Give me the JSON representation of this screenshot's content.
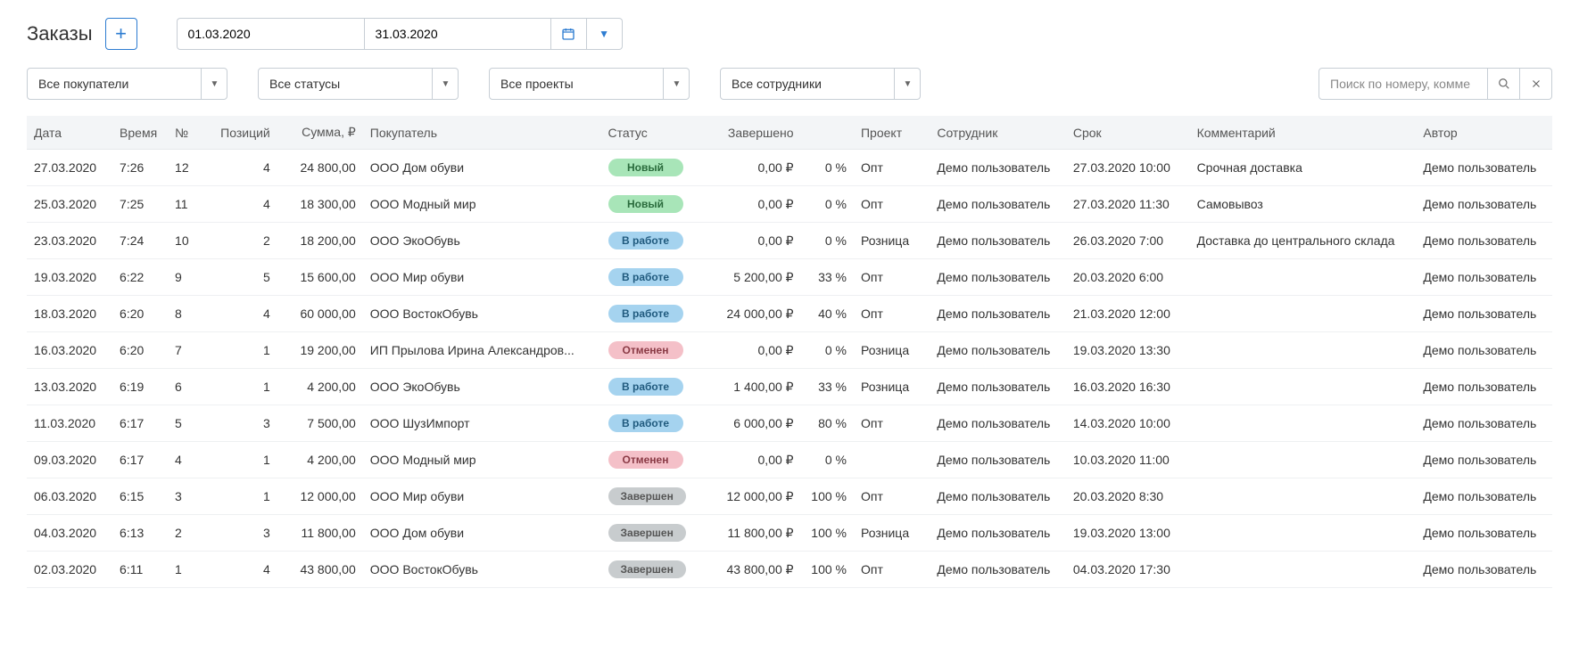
{
  "page_title": "Заказы",
  "date_from": "01.03.2020",
  "date_to": "31.03.2020",
  "filters": {
    "buyers": "Все покупатели",
    "statuses": "Все статусы",
    "projects": "Все проекты",
    "employees": "Все сотрудники"
  },
  "search_placeholder": "Поиск по номеру, комме",
  "columns": {
    "date": "Дата",
    "time": "Время",
    "num": "№",
    "positions": "Позиций",
    "sum": "Сумма, ₽",
    "buyer": "Покупатель",
    "status": "Статус",
    "completed": "Завершено",
    "percent": "",
    "project": "Проект",
    "employee": "Сотрудник",
    "due": "Срок",
    "comment": "Комментарий",
    "author": "Автор"
  },
  "status_labels": {
    "new": "Новый",
    "work": "В работе",
    "cancel": "Отменен",
    "done": "Завершен"
  },
  "rows": [
    {
      "date": "27.03.2020",
      "time": "7:26",
      "num": "12",
      "positions": "4",
      "sum": "24 800,00",
      "buyer": "ООО Дом обуви",
      "status": "new",
      "done": "0,00 ₽",
      "pct": "0 %",
      "project": "Опт",
      "employee": "Демо пользователь",
      "due": "27.03.2020 10:00",
      "due_overdue": false,
      "comment": "Срочная доставка",
      "author": "Демо пользователь"
    },
    {
      "date": "25.03.2020",
      "time": "7:25",
      "num": "11",
      "positions": "4",
      "sum": "18 300,00",
      "buyer": "ООО Модный мир",
      "status": "new",
      "done": "0,00 ₽",
      "pct": "0 %",
      "project": "Опт",
      "employee": "Демо пользователь",
      "due": "27.03.2020 11:30",
      "due_overdue": false,
      "comment": "Самовывоз",
      "author": "Демо пользователь"
    },
    {
      "date": "23.03.2020",
      "time": "7:24",
      "num": "10",
      "positions": "2",
      "sum": "18 200,00",
      "buyer": "ООО ЭкоОбувь",
      "status": "work",
      "done": "0,00 ₽",
      "pct": "0 %",
      "project": "Розница",
      "employee": "Демо пользователь",
      "due": "26.03.2020 7:00",
      "due_overdue": false,
      "comment": "Доставка до центрального склада",
      "author": "Демо пользователь"
    },
    {
      "date": "19.03.2020",
      "time": "6:22",
      "num": "9",
      "positions": "5",
      "sum": "15 600,00",
      "buyer": "ООО Мир обуви",
      "status": "work",
      "done": "5 200,00 ₽",
      "pct": "33 %",
      "project": "Опт",
      "employee": "Демо пользователь",
      "due": "20.03.2020 6:00",
      "due_overdue": false,
      "comment": "",
      "author": "Демо пользователь"
    },
    {
      "date": "18.03.2020",
      "time": "6:20",
      "num": "8",
      "positions": "4",
      "sum": "60 000,00",
      "buyer": "ООО ВостокОбувь",
      "status": "work",
      "done": "24 000,00 ₽",
      "pct": "40 %",
      "project": "Опт",
      "employee": "Демо пользователь",
      "due": "21.03.2020 12:00",
      "due_overdue": false,
      "comment": "",
      "author": "Демо пользователь"
    },
    {
      "date": "16.03.2020",
      "time": "6:20",
      "num": "7",
      "positions": "1",
      "sum": "19 200,00",
      "buyer": "ИП Прылова Ирина Александров...",
      "status": "cancel",
      "done": "0,00 ₽",
      "pct": "0 %",
      "project": "Розница",
      "employee": "Демо пользователь",
      "due": "19.03.2020 13:30",
      "due_overdue": false,
      "comment": "",
      "author": "Демо пользователь"
    },
    {
      "date": "13.03.2020",
      "time": "6:19",
      "num": "6",
      "positions": "1",
      "sum": "4 200,00",
      "buyer": "ООО ЭкоОбувь",
      "status": "work",
      "done": "1 400,00 ₽",
      "pct": "33 %",
      "project": "Розница",
      "employee": "Демо пользователь",
      "due": "16.03.2020 16:30",
      "due_overdue": true,
      "comment": "",
      "author": "Демо пользователь"
    },
    {
      "date": "11.03.2020",
      "time": "6:17",
      "num": "5",
      "positions": "3",
      "sum": "7 500,00",
      "buyer": "ООО ШузИмпорт",
      "status": "work",
      "done": "6 000,00 ₽",
      "pct": "80 %",
      "project": "Опт",
      "employee": "Демо пользователь",
      "due": "14.03.2020 10:00",
      "due_overdue": true,
      "comment": "",
      "author": "Демо пользователь"
    },
    {
      "date": "09.03.2020",
      "time": "6:17",
      "num": "4",
      "positions": "1",
      "sum": "4 200,00",
      "buyer": "ООО Модный мир",
      "status": "cancel",
      "done": "0,00 ₽",
      "pct": "0 %",
      "project": "",
      "employee": "Демо пользователь",
      "due": "10.03.2020 11:00",
      "due_overdue": false,
      "comment": "",
      "author": "Демо пользователь"
    },
    {
      "date": "06.03.2020",
      "time": "6:15",
      "num": "3",
      "positions": "1",
      "sum": "12 000,00",
      "buyer": "ООО Мир обуви",
      "status": "done",
      "done": "12 000,00 ₽",
      "pct": "100 %",
      "project": "Опт",
      "employee": "Демо пользователь",
      "due": "20.03.2020 8:30",
      "due_overdue": false,
      "comment": "",
      "author": "Демо пользователь"
    },
    {
      "date": "04.03.2020",
      "time": "6:13",
      "num": "2",
      "positions": "3",
      "sum": "11 800,00",
      "buyer": "ООО Дом обуви",
      "status": "done",
      "done": "11 800,00 ₽",
      "pct": "100 %",
      "project": "Розница",
      "employee": "Демо пользователь",
      "due": "19.03.2020 13:00",
      "due_overdue": false,
      "comment": "",
      "author": "Демо пользователь"
    },
    {
      "date": "02.03.2020",
      "time": "6:11",
      "num": "1",
      "positions": "4",
      "sum": "43 800,00",
      "buyer": "ООО ВостокОбувь",
      "status": "done",
      "done": "43 800,00 ₽",
      "pct": "100 %",
      "project": "Опт",
      "employee": "Демо пользователь",
      "due": "04.03.2020 17:30",
      "due_overdue": false,
      "comment": "",
      "author": "Демо пользователь"
    }
  ]
}
